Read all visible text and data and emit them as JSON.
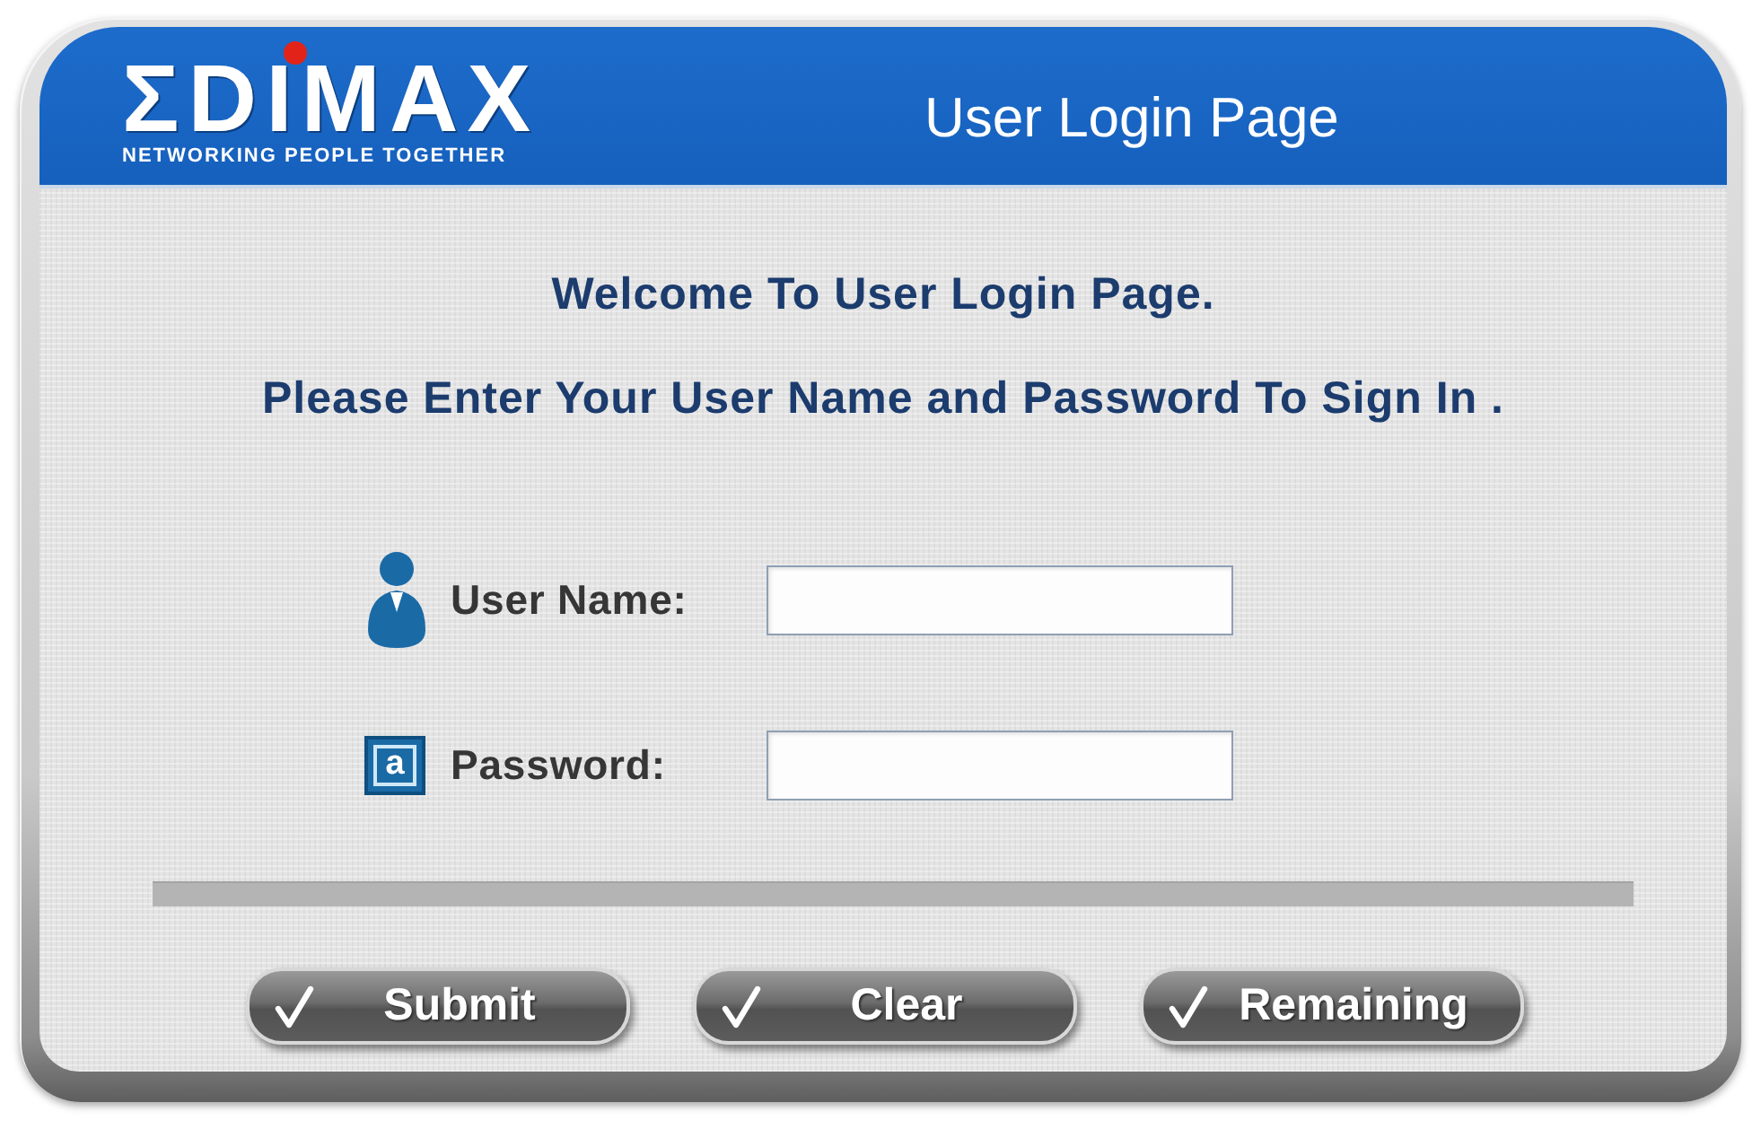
{
  "header": {
    "logo": {
      "wordmark": "ΣDIMAX",
      "tagline": "NETWORKING PEOPLE TOGETHER"
    },
    "title": "User Login Page"
  },
  "welcome": "Welcome To User Login Page.",
  "instructions": "Please Enter Your User Name and Password To Sign In .",
  "fields": [
    {
      "kind": "user",
      "label": "User Name:"
    },
    {
      "kind": "password",
      "label": "Password:",
      "icon_letter": "a"
    }
  ],
  "buttons": [
    {
      "label": "Submit"
    },
    {
      "label": "Clear"
    },
    {
      "label": "Remaining"
    }
  ]
}
